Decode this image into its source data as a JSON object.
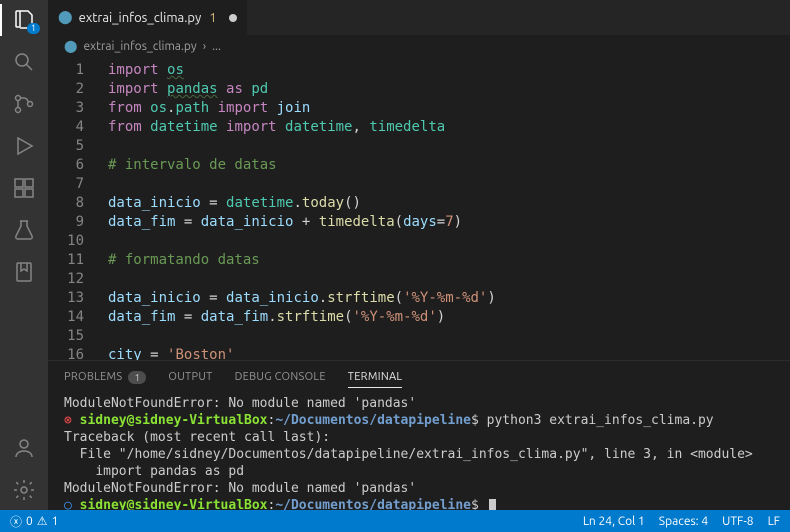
{
  "tab": {
    "filename": "extrai_infos_clima.py",
    "modCount": "1"
  },
  "breadcrumb": {
    "file": "extrai_infos_clima.py",
    "more": "..."
  },
  "explorerBadge": "1",
  "code": {
    "lines": [
      {
        "n": 1,
        "html": "<span class='kw'>import</span> <span class='mod underline'>os</span>"
      },
      {
        "n": 2,
        "html": "<span class='kw'>import</span> <span class='mod underline'>pandas</span> <span class='kw'>as</span> <span class='mod'>pd</span>"
      },
      {
        "n": 3,
        "html": "<span class='kw'>from</span> <span class='mod'>os</span>.<span class='mod'>path</span> <span class='kw'>import</span> <span class='var'>join</span>"
      },
      {
        "n": 4,
        "html": "<span class='kw'>from</span> <span class='mod'>datetime</span> <span class='kw'>import</span> <span class='mod'>datetime</span>, <span class='mod'>timedelta</span>"
      },
      {
        "n": 5,
        "html": ""
      },
      {
        "n": 6,
        "html": "<span class='cmt'># intervalo de datas</span>"
      },
      {
        "n": 7,
        "html": ""
      },
      {
        "n": 8,
        "html": "<span class='var'>data_inicio</span> <span class='op'>=</span> <span class='mod'>datetime</span>.<span class='fn'>today</span>()"
      },
      {
        "n": 9,
        "html": "<span class='var'>data_fim</span> <span class='op'>=</span> <span class='var'>data_inicio</span> <span class='op'>+</span> <span class='fn'>timedelta</span>(<span class='var'>days</span><span class='op'>=</span><span class='str'>7</span>)"
      },
      {
        "n": 10,
        "html": ""
      },
      {
        "n": 11,
        "html": "<span class='cmt'># formatando datas</span>"
      },
      {
        "n": 12,
        "html": ""
      },
      {
        "n": 13,
        "html": "<span class='var'>data_inicio</span> <span class='op'>=</span> <span class='var'>data_inicio</span>.<span class='fn'>strftime</span>(<span class='str'>'%Y-%m-%d'</span>)"
      },
      {
        "n": 14,
        "html": "<span class='var'>data_fim</span> <span class='op'>=</span> <span class='var'>data_fim</span>.<span class='fn'>strftime</span>(<span class='str'>'%Y-%m-%d'</span>)"
      },
      {
        "n": 15,
        "html": ""
      },
      {
        "n": 16,
        "html": "<span class='var'>city</span> <span class='op'>=</span> <span class='str'>'Boston'</span>"
      }
    ]
  },
  "panel": {
    "tabs": {
      "problems": "PROBLEMS",
      "problemsBadge": "1",
      "output": "OUTPUT",
      "debug": "DEBUG CONSOLE",
      "terminal": "TERMINAL"
    }
  },
  "terminal": {
    "line1": "ModuleNotFoundError: No module named 'pandas'",
    "prompt1_user": "sidney@sidney-VirtualBox",
    "prompt1_sep": ":",
    "prompt1_path": "~/Documentos/datapipeline",
    "prompt1_end": "$",
    "cmd1": " python3 extrai_infos_clima.py",
    "trace1": "Traceback (most recent call last):",
    "trace2": "  File \"/home/sidney/Documentos/datapipeline/extrai_infos_clima.py\", line 3, in <module>",
    "trace3": "    import pandas as pd",
    "err2": "ModuleNotFoundError: No module named 'pandas'",
    "prompt2_user": "sidney@sidney-VirtualBox",
    "prompt2_path": "~/Documentos/datapipeline",
    "prompt2_end": "$"
  },
  "status": {
    "errors": "0",
    "warnings": "1",
    "lineCol": "Ln 24, Col 1",
    "spaces": "Spaces: 4",
    "encoding": "UTF-8",
    "eol": "LF"
  }
}
